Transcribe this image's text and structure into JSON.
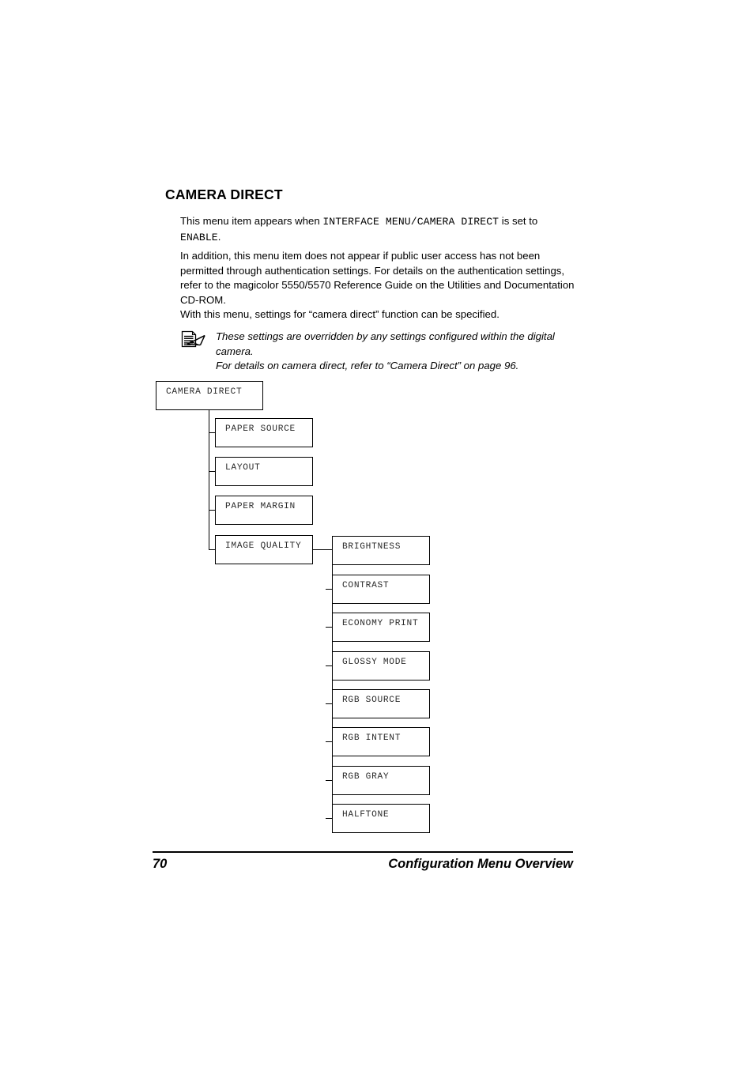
{
  "heading": "CAMERA DIRECT",
  "paragraphs": {
    "p1_a": "This menu item appears when ",
    "p1_mono1": "INTERFACE MENU/CAMERA DIRECT",
    "p1_b": " is set to ",
    "p1_mono2": "ENABLE",
    "p1_c": ".",
    "p2": "In addition, this menu item does not appear if public user access has not been permitted through authentication settings. For details on the authentication settings, refer to the magicolor 5550/5570 Reference Guide on the Utilities and Documentation CD-ROM.",
    "p3": "With this menu, settings for “camera direct” function can be specified."
  },
  "note": {
    "icon": "note-pencil-icon",
    "line1": "These settings are overridden by any settings configured within the digital camera.",
    "line2": "For details on camera direct, refer to “Camera Direct” on page 96."
  },
  "tree": {
    "root": "CAMERA DIRECT",
    "level1": [
      "PAPER SOURCE",
      "LAYOUT",
      "PAPER MARGIN",
      "IMAGE QUALITY"
    ],
    "level2": [
      "BRIGHTNESS",
      "CONTRAST",
      "ECONOMY PRINT",
      "GLOSSY MODE",
      "RGB SOURCE",
      "RGB INTENT",
      "RGB GRAY",
      "HALFTONE"
    ]
  },
  "footer": {
    "page_number": "70",
    "title": "Configuration Menu Overview"
  }
}
